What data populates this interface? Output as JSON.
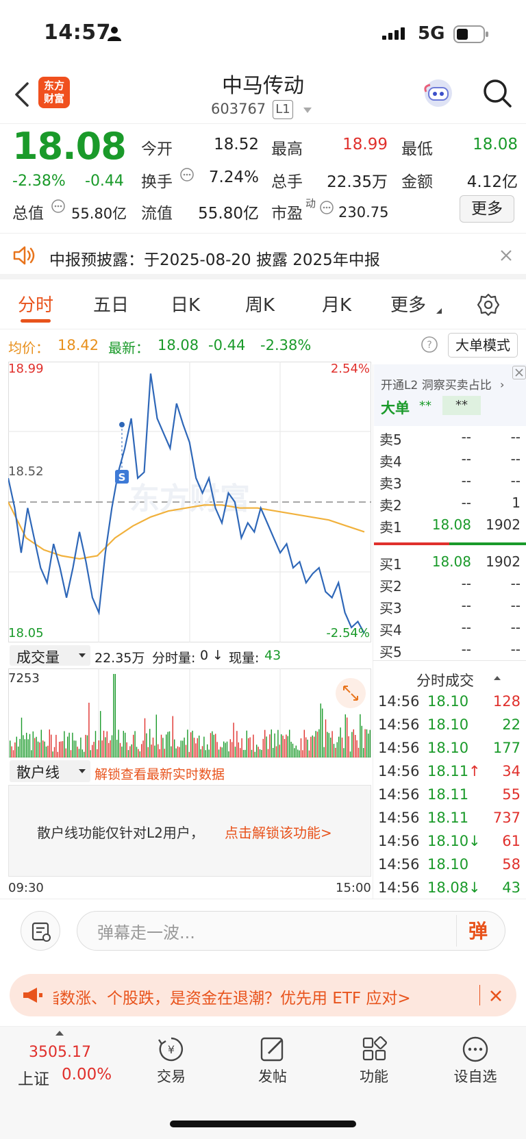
{
  "status_bar": {
    "time": "14:57",
    "network": "5G"
  },
  "header": {
    "title": "中马传动",
    "code": "603767",
    "level": "L1",
    "logo_text": "东方财富"
  },
  "quote": {
    "price": "18.08",
    "change_pct": "-2.38%",
    "change": "-0.44",
    "open_label": "今开",
    "open": "18.52",
    "high_label": "最高",
    "high": "18.99",
    "low_label": "最低",
    "low": "18.08",
    "turnover_label": "换手",
    "turnover": "7.24%",
    "volume_label": "总手",
    "volume": "22.35万",
    "amount_label": "金额",
    "amount": "4.12亿",
    "mktcap_label": "总值",
    "mktcap": "55.80亿",
    "float_label": "流值",
    "float": "55.80亿",
    "pe_label": "市盈",
    "pe_sup": "动",
    "pe": "230.75",
    "more": "更多"
  },
  "banner": {
    "text": "中报预披露：于2025-08-20 披露 2025年中报"
  },
  "tabs": [
    "分时",
    "五日",
    "日K",
    "周K",
    "月K",
    "更多"
  ],
  "info_line": {
    "avg_label": "均价：",
    "avg": "18.42",
    "latest_label": "最新：",
    "latest": "18.08",
    "change": "-0.44",
    "change_pct": "-2.38%",
    "mode": "大单模式"
  },
  "chart_labels": {
    "y_high": "18.99",
    "y_mid": "18.52",
    "y_low": "18.05",
    "pct_high": "2.54%",
    "pct_low": "-2.54%",
    "vol_max": "7253",
    "time_start": "09:30",
    "time_end": "15:00"
  },
  "chart_data": {
    "type": "line",
    "ylim": [
      18.05,
      18.99
    ],
    "x": [
      "09:30",
      "15:00"
    ],
    "series": [],
    "price_line": [
      18.6,
      18.5,
      18.35,
      18.5,
      18.4,
      18.3,
      18.25,
      18.38,
      18.3,
      18.2,
      18.3,
      18.42,
      18.32,
      18.2,
      18.15,
      18.35,
      18.5,
      18.62,
      18.7,
      18.8,
      18.6,
      18.62,
      18.95,
      18.8,
      18.75,
      18.7,
      18.85,
      18.78,
      18.72,
      18.6,
      18.55,
      18.6,
      18.5,
      18.45,
      18.55,
      18.52,
      18.4,
      18.45,
      18.42,
      18.5,
      18.45,
      18.4,
      18.35,
      18.38,
      18.3,
      18.32,
      18.25,
      18.28,
      18.3,
      18.22,
      18.2,
      18.25,
      18.15,
      18.1,
      18.12,
      18.08
    ],
    "avg_line": [
      18.52,
      18.4,
      18.36,
      18.34,
      18.33,
      18.34,
      18.4,
      18.44,
      18.47,
      18.49,
      18.5,
      18.51,
      18.51,
      18.5,
      18.5,
      18.49,
      18.48,
      18.47,
      18.46,
      18.44,
      18.42
    ]
  },
  "volume_bar": {
    "label": "成交量",
    "total": "22.35万",
    "tick_label": "分时量:",
    "tick": "0",
    "arrow": "↓",
    "now_label": "现量:",
    "now": "43"
  },
  "retail": {
    "label": "散户线",
    "unlock": "解锁查看最新实时数据",
    "notice": "散户线功能仅针对L2用户，",
    "notice_link": "点击解锁该功能>"
  },
  "orderbook": {
    "promo": "开通L2 洞察买卖占比",
    "big_label": "大单",
    "big_a": "**",
    "big_b": "**",
    "sell": [
      [
        "卖5",
        "--",
        "--"
      ],
      [
        "卖4",
        "--",
        "--"
      ],
      [
        "卖3",
        "--",
        "--"
      ],
      [
        "卖2",
        "--",
        "1"
      ],
      [
        "卖1",
        "18.08",
        "1902"
      ]
    ],
    "buy": [
      [
        "买1",
        "18.08",
        "1902"
      ],
      [
        "买2",
        "--",
        "--"
      ],
      [
        "买3",
        "--",
        "--"
      ],
      [
        "买4",
        "--",
        "--"
      ],
      [
        "买5",
        "--",
        "--"
      ]
    ]
  },
  "trades": {
    "title": "分时成交",
    "rows": [
      [
        "14:56",
        "18.10",
        "128",
        "",
        "red"
      ],
      [
        "14:56",
        "18.10",
        "22",
        "",
        "green"
      ],
      [
        "14:56",
        "18.10",
        "177",
        "",
        "green"
      ],
      [
        "14:56",
        "18.11",
        "34",
        "↑",
        "red"
      ],
      [
        "14:56",
        "18.11",
        "55",
        "",
        "red"
      ],
      [
        "14:56",
        "18.11",
        "737",
        "",
        "red"
      ],
      [
        "14:56",
        "18.10",
        "61",
        "↓",
        "red"
      ],
      [
        "14:56",
        "18.10",
        "58",
        "",
        "red"
      ],
      [
        "14:56",
        "18.08",
        "43",
        "↓",
        "green"
      ]
    ]
  },
  "comment": {
    "placeholder": "弹幕走一波...",
    "send": "弹"
  },
  "ad": {
    "text": "指数涨、个股跌，是资金在退潮？优先用 ETF 应对>"
  },
  "bottom_nav": {
    "index_value": "3505.17",
    "index_name": "上证",
    "index_change": "0.00%",
    "items": [
      "交易",
      "发帖",
      "功能",
      "设自选"
    ]
  }
}
